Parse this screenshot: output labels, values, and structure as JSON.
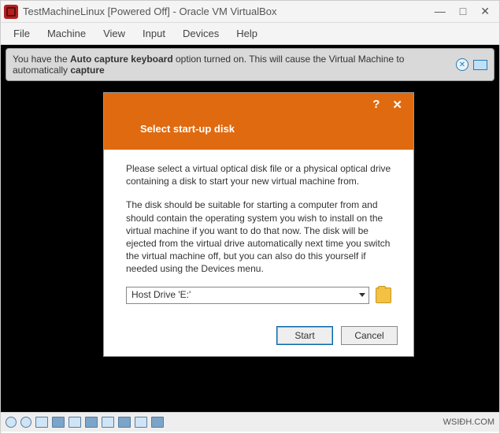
{
  "window": {
    "title": "TestMachineLinux [Powered Off] - Oracle VM VirtualBox",
    "controls": {
      "minimize": "—",
      "maximize": "□",
      "close": "✕"
    }
  },
  "menu": {
    "file": "File",
    "machine": "Machine",
    "view": "View",
    "input": "Input",
    "devices": "Devices",
    "help": "Help"
  },
  "notification": {
    "prefix": "You have the ",
    "bold1": "Auto capture keyboard",
    "mid": " option turned on. This will cause the Virtual Machine to automatically ",
    "bold2": "capture"
  },
  "dialog": {
    "help": "?",
    "close": "✕",
    "title": "Select start-up disk",
    "para1": "Please select a virtual optical disk file or a physical optical drive containing a disk to start your new virtual machine from.",
    "para2": "The disk should be suitable for starting a computer from and should contain the operating system you wish to install on the virtual machine if you want to do that now. The disk will be ejected from the virtual drive automatically next time you switch the virtual machine off, but you can also do this yourself if needed using the Devices menu.",
    "drive_selected": "Host Drive 'E:'",
    "start": "Start",
    "cancel": "Cancel"
  },
  "status": {
    "right_text": "WSIĐH.COM"
  }
}
